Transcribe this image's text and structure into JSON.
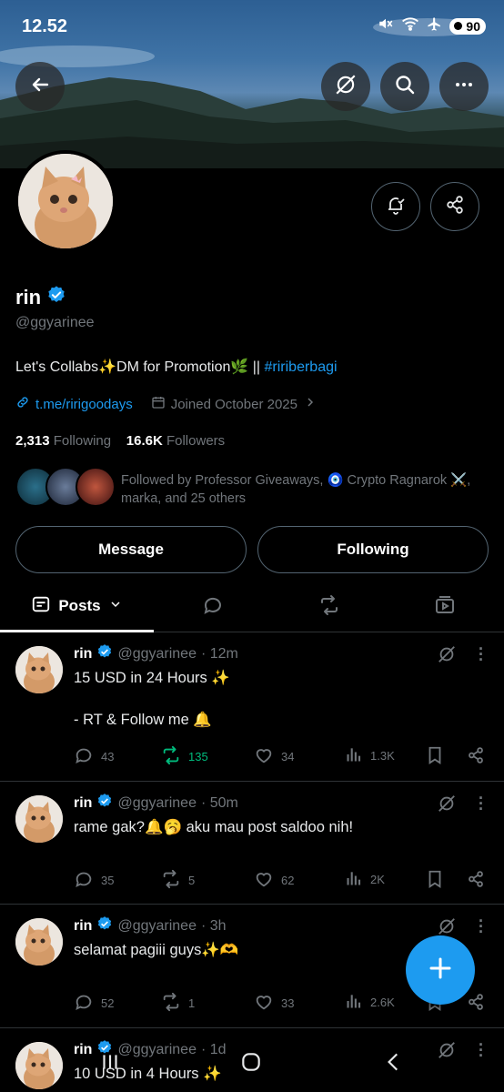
{
  "status_bar": {
    "time": "12.52",
    "battery": "90"
  },
  "profile": {
    "name": "rin",
    "handle": "@ggyarinee",
    "bio_text": "Let's Collabs✨DM for Promotion🌿 || ",
    "bio_hashtag": "#ririberbagi",
    "link": "t.me/ririgoodays",
    "joined": "Joined October 2025",
    "following_count": "2,313",
    "following_label": "Following",
    "followers_count": "16.6K",
    "followers_label": "Followers",
    "followed_by": "Followed by Professor Giveaways, 🧿 Crypto Ragnarok ⚔️, marka, and 25 others",
    "message_button": "Message",
    "following_button": "Following"
  },
  "tabs": {
    "posts": "Posts"
  },
  "posts": [
    {
      "name": "rin",
      "handle": "@ggyarinee",
      "time": "· 12m",
      "text": "15 USD in 24 Hours ✨\n\n- RT & Follow me 🔔",
      "replies": "43",
      "reposts": "135",
      "likes": "34",
      "views": "1.3K"
    },
    {
      "name": "rin",
      "handle": "@ggyarinee",
      "time": "· 50m",
      "text": "rame gak?🔔🥱 aku mau post saldoo nih!",
      "replies": "35",
      "reposts": "5",
      "likes": "62",
      "views": "2K"
    },
    {
      "name": "rin",
      "handle": "@ggyarinee",
      "time": "· 3h",
      "text": "selamat pagiii guys✨🫶",
      "replies": "52",
      "reposts": "1",
      "likes": "33",
      "views": "2.6K"
    },
    {
      "name": "rin",
      "handle": "@ggyarinee",
      "time": "· 1d",
      "text": "10 USD in 4 Hours ✨"
    }
  ],
  "colors": {
    "accent": "#1d9bf0",
    "repost_active": "#00ba7c",
    "muted": "#71767b"
  }
}
